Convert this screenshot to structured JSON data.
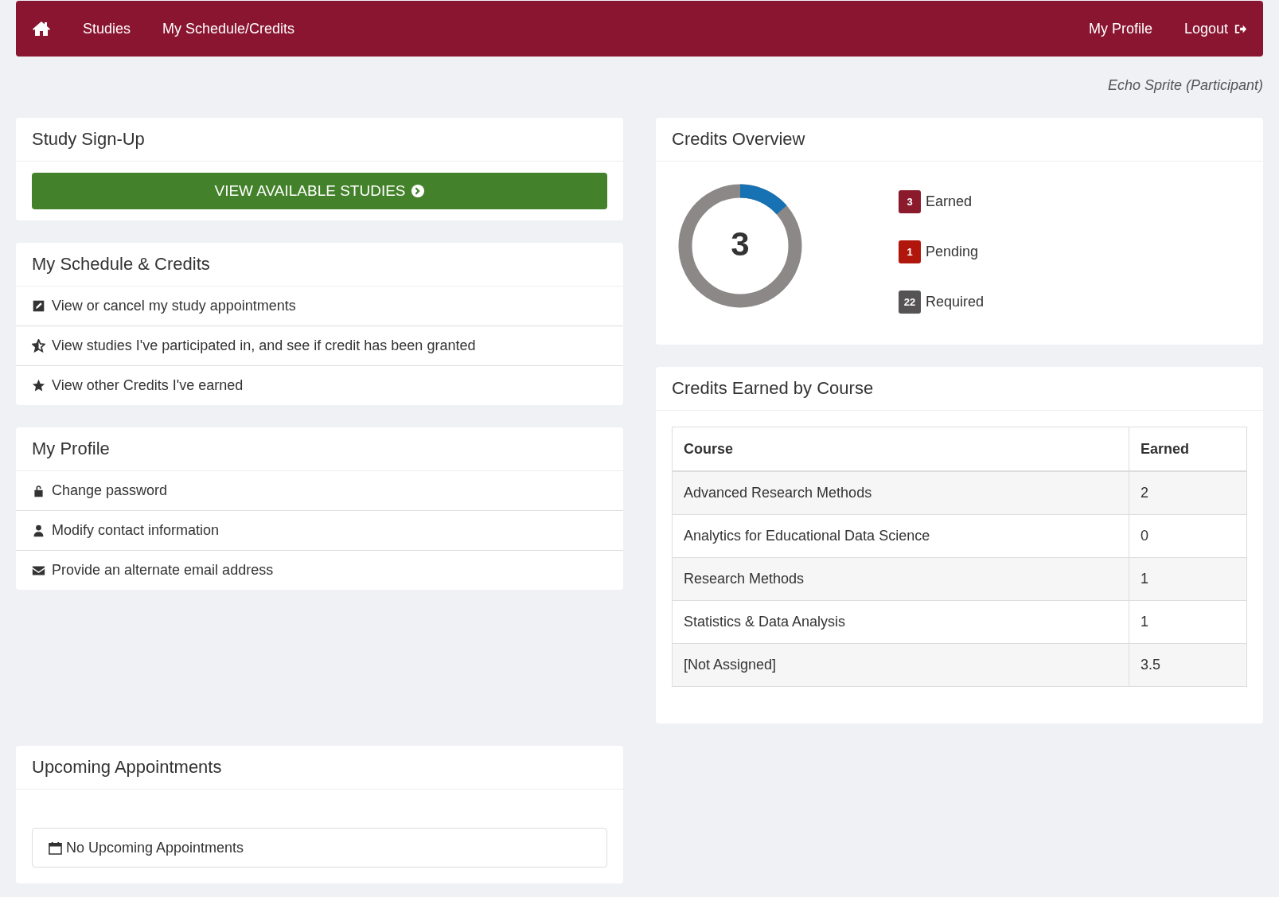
{
  "navbar": {
    "left": [
      {
        "kind": "home"
      },
      {
        "kind": "text",
        "label": "Studies"
      },
      {
        "kind": "text",
        "label": "My Schedule/Credits"
      }
    ],
    "right": [
      {
        "kind": "text",
        "label": "My Profile"
      },
      {
        "kind": "logout",
        "label": "Logout"
      }
    ]
  },
  "user": "Echo Sprite (Participant)",
  "signup": {
    "title": "Study Sign-Up",
    "button": "VIEW AVAILABLE STUDIES"
  },
  "schedule": {
    "title": "My Schedule & Credits",
    "items": [
      {
        "kind": "edit",
        "label": "View or cancel my study appointments"
      },
      {
        "kind": "star-half",
        "label": "View studies I've participated in, and see if credit has been granted"
      },
      {
        "kind": "star",
        "label": "View other Credits I've earned"
      }
    ]
  },
  "profile": {
    "title": "My Profile",
    "items": [
      {
        "kind": "lock",
        "label": "Change password"
      },
      {
        "kind": "user",
        "label": "Modify contact information"
      },
      {
        "kind": "envelope",
        "label": "Provide an alternate email address"
      }
    ]
  },
  "overview": {
    "title": "Credits Overview",
    "donut": {
      "value": "3",
      "level": 0.136
    },
    "legend": [
      {
        "count": "3",
        "label": "Earned",
        "color": "#8a1a2c"
      },
      {
        "count": "1",
        "label": "Pending",
        "color": "#b0160c"
      },
      {
        "count": "22",
        "label": "Required",
        "color": "#555353"
      }
    ]
  },
  "by_course": {
    "title": "Credits Earned by Course",
    "columns": [
      "Course",
      "Earned"
    ],
    "rows": [
      [
        "Advanced Research Methods",
        "2"
      ],
      [
        "Analytics for Educational Data Science",
        "0"
      ],
      [
        "Research Methods",
        "1"
      ],
      [
        "Statistics & Data Analysis",
        "1"
      ],
      [
        "[Not Assigned]",
        "3.5"
      ]
    ]
  },
  "upcoming": {
    "title": "Upcoming Appointments",
    "empty": "No Upcoming Appointments"
  }
}
